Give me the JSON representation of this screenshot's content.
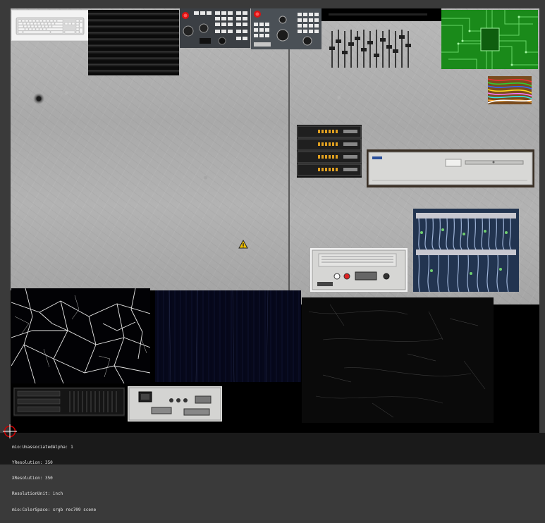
{
  "metadata_lines": [
    "mio:UnassociatedAlpha: 1",
    "YResolution: 350",
    "XResolution: 350",
    "ResolutionUnit: inch",
    "mio:ColorSpace: srgb rec709 scene"
  ],
  "icons": {
    "cursor": "crosshair-target-icon",
    "warning": "warning-triangle-icon"
  },
  "colors": {
    "concrete": "#b0b0b0",
    "pcb_green": "#1a8a1a",
    "background": "#3a3a3a",
    "warning_yellow": "#f2c200"
  }
}
